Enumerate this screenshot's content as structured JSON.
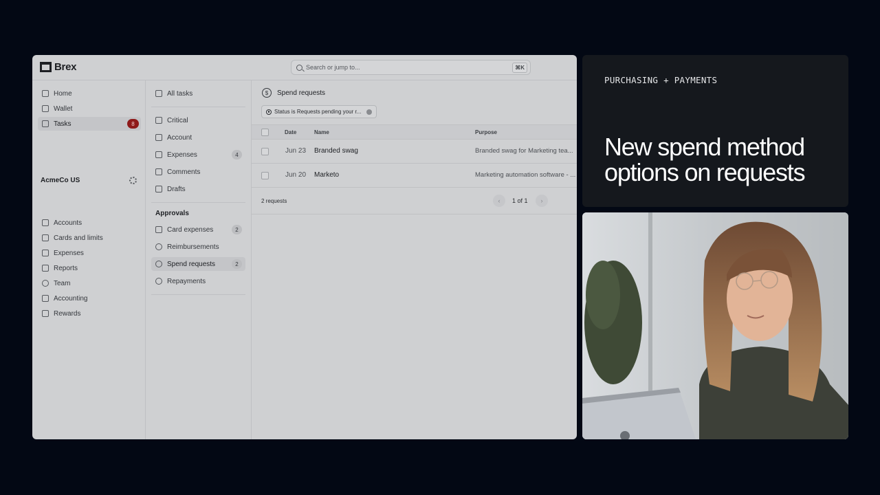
{
  "app": {
    "brand": "Brex",
    "search": {
      "placeholder": "Search or jump to...",
      "shortcut": "⌘K"
    },
    "sidebar": {
      "items": [
        {
          "label": "Home",
          "icon": "home-icon"
        },
        {
          "label": "Wallet",
          "icon": "wallet-icon"
        },
        {
          "label": "Tasks",
          "icon": "check-square-icon",
          "badge": "8",
          "active": true
        }
      ],
      "org_name": "AcmeCo US",
      "org_items": [
        {
          "label": "Accounts",
          "icon": "bank-icon"
        },
        {
          "label": "Cards and limits",
          "icon": "card-icon"
        },
        {
          "label": "Expenses",
          "icon": "receipt-icon"
        },
        {
          "label": "Reports",
          "icon": "chart-icon"
        },
        {
          "label": "Team",
          "icon": "users-icon"
        },
        {
          "label": "Accounting",
          "icon": "book-icon"
        },
        {
          "label": "Rewards",
          "icon": "gift-icon"
        }
      ]
    },
    "tasks_nav": {
      "all_tasks": "All tasks",
      "items": [
        {
          "label": "Critical",
          "icon": "warning-icon"
        },
        {
          "label": "Account",
          "icon": "flag-icon"
        },
        {
          "label": "Expenses",
          "icon": "receipt-icon",
          "count": "4"
        },
        {
          "label": "Comments",
          "icon": "comment-icon"
        },
        {
          "label": "Drafts",
          "icon": "pencil-icon"
        }
      ],
      "approvals_heading": "Approvals",
      "approvals": [
        {
          "label": "Card expenses",
          "icon": "card-icon",
          "count": "2"
        },
        {
          "label": "Reimbursements",
          "icon": "refund-icon"
        },
        {
          "label": "Spend requests",
          "icon": "dollar-icon",
          "count": "2",
          "active": true
        },
        {
          "label": "Repayments",
          "icon": "repay-icon"
        }
      ]
    },
    "main": {
      "title": "Spend requests",
      "filter": "Status is Requests pending your r...",
      "columns": {
        "date": "Date",
        "name": "Name",
        "purpose": "Purpose"
      },
      "rows": [
        {
          "date": "Jun 23",
          "name": "Branded swag",
          "purpose": "Branded swag for Marketing tea..."
        },
        {
          "date": "Jun 20",
          "name": "Marketo",
          "purpose": "Marketing automation software - ..."
        }
      ],
      "footer_count": "2 requests",
      "pager": "1 of 1"
    }
  },
  "card": {
    "eyebrow": "PURCHASING + PAYMENTS",
    "headline": "New spend method options on requests"
  }
}
